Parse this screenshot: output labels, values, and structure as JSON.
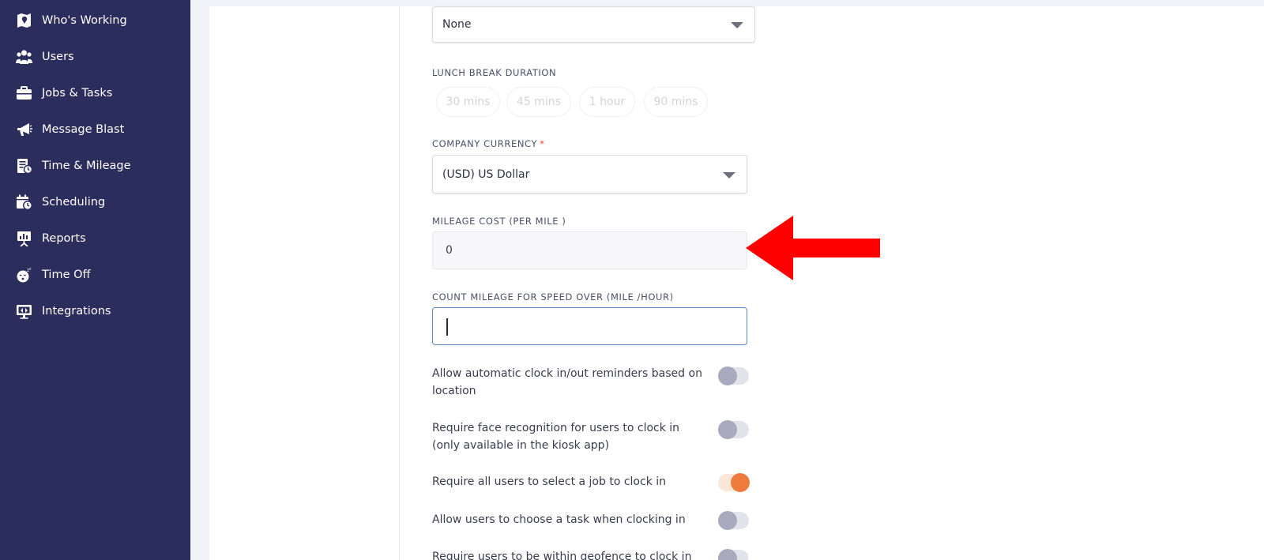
{
  "sidebar": {
    "items": [
      {
        "label": "Who's Working",
        "icon": "map-pin-icon"
      },
      {
        "label": "Users",
        "icon": "users-icon"
      },
      {
        "label": "Jobs & Tasks",
        "icon": "briefcase-icon"
      },
      {
        "label": "Message Blast",
        "icon": "megaphone-icon"
      },
      {
        "label": "Time & Mileage",
        "icon": "timesheet-icon"
      },
      {
        "label": "Scheduling",
        "icon": "calendar-clock-icon"
      },
      {
        "label": "Reports",
        "icon": "presentation-icon"
      },
      {
        "label": "Time Off",
        "icon": "sleeping-face-icon"
      },
      {
        "label": "Integrations",
        "icon": "monitor-icon"
      }
    ]
  },
  "form": {
    "top_select_value": "None",
    "lunch_break": {
      "label": "LUNCH BREAK DURATION",
      "options": [
        "30 mins",
        "45 mins",
        "1 hour",
        "90 mins"
      ]
    },
    "currency": {
      "label": "COMPANY CURRENCY",
      "required_mark": "*",
      "value": "(USD) US Dollar"
    },
    "mileage_cost": {
      "label": "MILEAGE COST (PER MILE )",
      "value": "0"
    },
    "speed_threshold": {
      "label": "COUNT MILEAGE FOR SPEED OVER (MILE /HOUR)",
      "value": ""
    },
    "toggles": [
      {
        "label": "Allow automatic clock in/out reminders based on location",
        "on": false
      },
      {
        "label": "Require face recognition for users to clock in (only available in the kiosk app)",
        "on": false
      },
      {
        "label": "Require all users to select a job to clock in",
        "on": true
      },
      {
        "label": "Allow users to choose a task when clocking in",
        "on": false
      },
      {
        "label": "Require users to be within geofence to clock in",
        "on": false
      }
    ]
  },
  "colors": {
    "sidebar_bg": "#2b2d5c",
    "toggle_on": "#ef7a3e",
    "annotation_arrow": "#ff0000"
  }
}
